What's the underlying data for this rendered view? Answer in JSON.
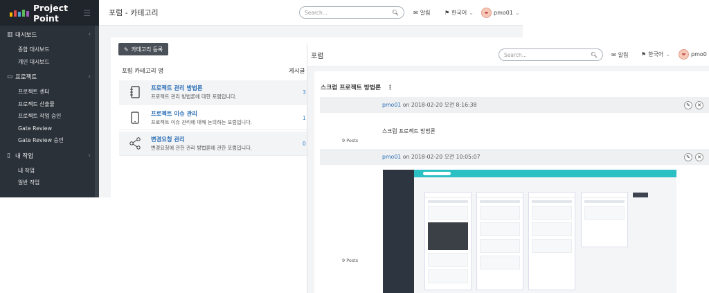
{
  "back_window": {
    "brand": "Project Point",
    "page_title": "포럼 - 카테고리",
    "search_placeholder": "Search...",
    "header": {
      "notifications": "알림",
      "language": "한국어",
      "user": "pmo01"
    },
    "sidebar": [
      {
        "section": "대시보드",
        "items": [
          "종합 대시보드",
          "개인 대시보드"
        ]
      },
      {
        "section": "프로젝트",
        "items": [
          "프로젝트 센터",
          "프로젝트 산출물",
          "프로젝트 작업 승인",
          "Gate Review",
          "Gate Review 승인"
        ]
      },
      {
        "section": "내 작업",
        "items": [
          "내 작업",
          "일반 작업"
        ]
      }
    ],
    "add_category_button": "카테고리 등록",
    "col_name": "포럼 카테고리 명",
    "col_posts": "게시글",
    "categories": [
      {
        "name": "프로젝트 관리 방법론",
        "desc": "프로젝트 관리 방법론에 대한 포럼입니다.",
        "count": "3"
      },
      {
        "name": "프로젝트 이슈 관리",
        "desc": "프로젝트 이슈 관리에 대해 논의하는 포럼입니다.",
        "count": "1"
      },
      {
        "name": "변경요청 관리",
        "desc": "변경요청에 관한 관리 방법론에 관한 포럼입니다.",
        "count": "0"
      }
    ]
  },
  "front_window": {
    "page_title": "포럼",
    "search_placeholder": "Search...",
    "header": {
      "notifications": "알림",
      "language": "한국어",
      "user": "pmo0"
    },
    "forum_title": "스크럼 프로젝트 방법론",
    "posts": [
      {
        "author": "pmo01",
        "date": " on 2018-02-20 오전 8:16:38",
        "body": "스크럼 프로젝트 방법론",
        "post_count": "9 Posts"
      },
      {
        "author": "pmo01",
        "date": " on 2018-02-20 오전 10:05:07",
        "post_count": "9 Posts"
      }
    ]
  }
}
